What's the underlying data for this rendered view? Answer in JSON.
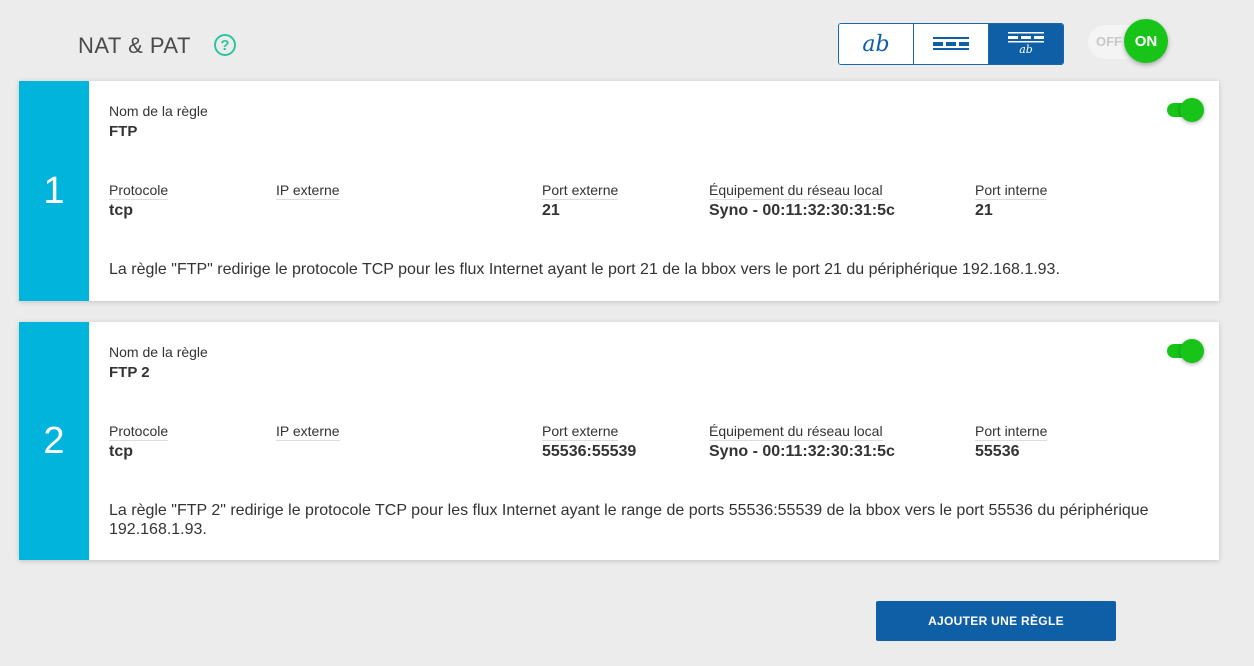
{
  "header": {
    "title": "NAT & PAT",
    "help_glyph": "?",
    "view_modes": [
      {
        "icon": "text-view-icon",
        "glyph": "ab",
        "active": false
      },
      {
        "icon": "list-view-icon",
        "active": false
      },
      {
        "icon": "list-text-view-icon",
        "glyph": "ab",
        "active": true
      }
    ],
    "master_toggle": {
      "off_label": "OFF",
      "on_label": "ON",
      "state": "on"
    }
  },
  "labels": {
    "rule_name": "Nom de la règle",
    "protocol": "Protocole",
    "external_ip": "IP externe",
    "external_port": "Port externe",
    "local_device": "Équipement du réseau local",
    "internal_port": "Port interne"
  },
  "rules": [
    {
      "number": "1",
      "name": "FTP",
      "protocol": "tcp",
      "external_ip": "",
      "external_port": "21",
      "local_device": "Syno - 00:11:32:30:31:5c",
      "internal_port": "21",
      "description": "La règle \"FTP\" redirige le protocole TCP pour les flux Internet ayant le port 21 de la bbox vers le port 21 du périphérique 192.168.1.93.",
      "enabled": true
    },
    {
      "number": "2",
      "name": "FTP 2",
      "protocol": "tcp",
      "external_ip": "",
      "external_port": "55536:55539",
      "local_device": "Syno - 00:11:32:30:31:5c",
      "internal_port": "55536",
      "description": "La règle \"FTP 2\" redirige le protocole TCP pour les flux Internet ayant le range de ports 55536:55539 de la bbox vers le port 55536 du périphérique 192.168.1.93.",
      "enabled": true
    }
  ],
  "actions": {
    "add_rule": "AJOUTER UNE RÈGLE"
  },
  "colors": {
    "accent_cyan": "#00b4dc",
    "primary_blue": "#0f5fa6",
    "toggle_green": "#19c419",
    "help_teal": "#2ec4a0"
  }
}
